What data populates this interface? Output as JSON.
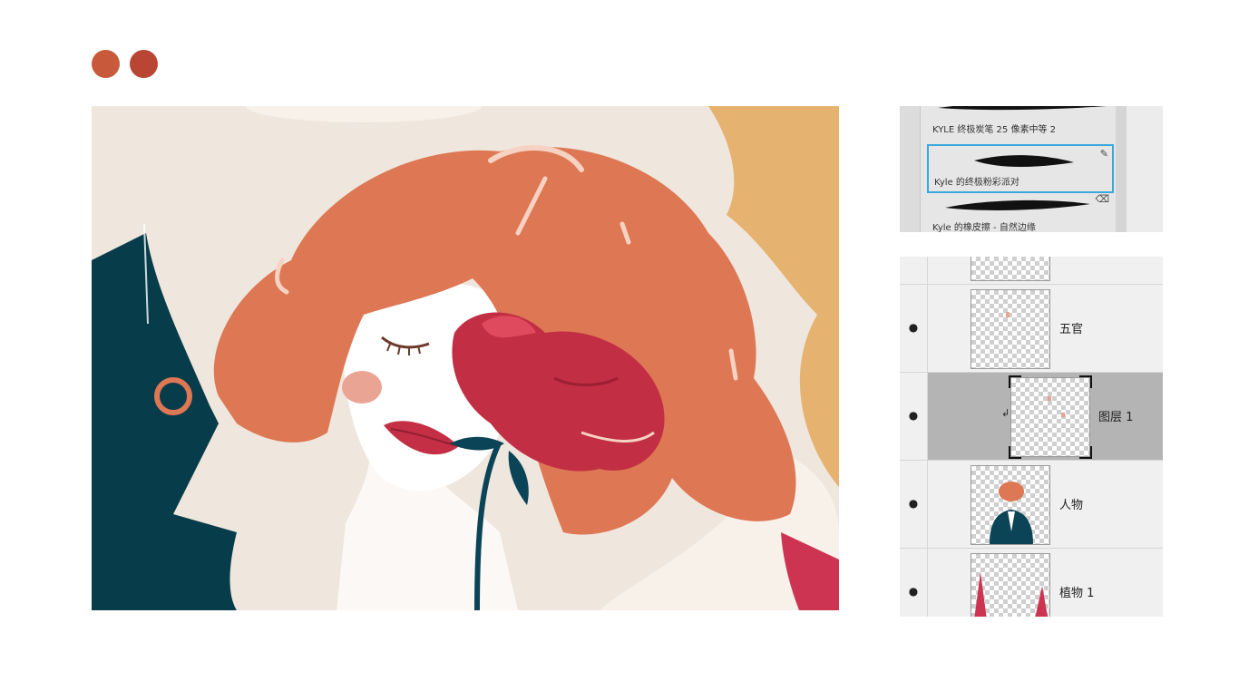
{
  "colors": {
    "dot_1": "#c85a3b",
    "dot_2": "#b94534",
    "selection_border": "#3aa7dd",
    "selected_layer_bg": "#b4b4b4"
  },
  "brushes": [
    {
      "label": "KYLE 终极炭笔 25 像素中等 2",
      "selected": false,
      "icon": "brush-icon"
    },
    {
      "label": "Kyle 的终极粉彩派对",
      "selected": true,
      "icon": "brush-icon"
    },
    {
      "label": "Kyle 的橡皮擦 - 自然边缘",
      "selected": false,
      "icon": "eraser-icon"
    }
  ],
  "layers": [
    {
      "name": "",
      "visible": true,
      "selected": false,
      "clipped": false
    },
    {
      "name": "五官",
      "visible": true,
      "selected": false,
      "clipped": false
    },
    {
      "name": "图层 1",
      "visible": true,
      "selected": true,
      "clipped": true
    },
    {
      "name": "人物",
      "visible": true,
      "selected": false,
      "clipped": false
    },
    {
      "name": "植物 1",
      "visible": true,
      "selected": false,
      "clipped": false
    }
  ]
}
